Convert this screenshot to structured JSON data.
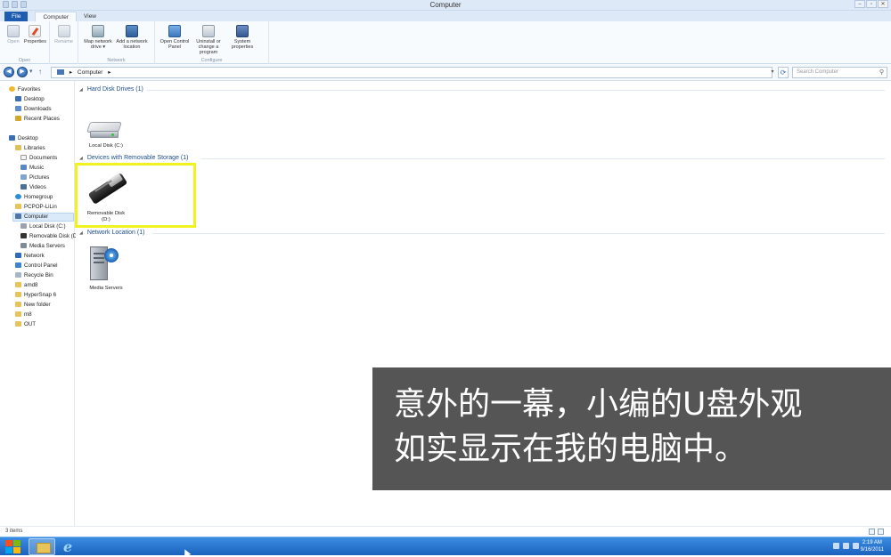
{
  "window": {
    "title": "Computer"
  },
  "tabs": [
    {
      "label": "File"
    },
    {
      "label": "Computer"
    },
    {
      "label": "View"
    }
  ],
  "ribbon": {
    "groups": [
      {
        "label": "Open",
        "buttons": [
          {
            "label": "Open"
          },
          {
            "label": "Properties"
          }
        ]
      },
      {
        "label": "",
        "buttons": [
          {
            "label": "Rename"
          }
        ]
      },
      {
        "label": "Network",
        "buttons": [
          {
            "label": "Map network drive ▾"
          },
          {
            "label": "Add a network location"
          }
        ]
      },
      {
        "label": "Configure",
        "buttons": [
          {
            "label": "Open Control Panel"
          },
          {
            "label": "Uninstall or change a program"
          },
          {
            "label": "System properties"
          }
        ]
      }
    ]
  },
  "address": {
    "path": "Computer",
    "search_placeholder": "Search Computer"
  },
  "nav": [
    {
      "label": "Favorites",
      "icon": "star-icon"
    },
    {
      "label": "Desktop",
      "icon": "desktop-icon"
    },
    {
      "label": "Downloads",
      "icon": "downloads-icon"
    },
    {
      "label": "Recent Places",
      "icon": "recent-places-icon"
    },
    {
      "label": "Desktop",
      "icon": "desktop-icon"
    },
    {
      "label": "Libraries",
      "icon": "libraries-icon"
    },
    {
      "label": "Documents",
      "icon": "documents-icon"
    },
    {
      "label": "Music",
      "icon": "music-icon"
    },
    {
      "label": "Pictures",
      "icon": "pictures-icon"
    },
    {
      "label": "Videos",
      "icon": "videos-icon"
    },
    {
      "label": "Homegroup",
      "icon": "homegroup-icon"
    },
    {
      "label": "PCPOP-LiLin",
      "icon": "user-folder-icon"
    },
    {
      "label": "Computer",
      "icon": "computer-icon"
    },
    {
      "label": "Local Disk (C:)",
      "icon": "hard-drive-icon"
    },
    {
      "label": "Removable Disk (D",
      "icon": "usb-drive-icon"
    },
    {
      "label": "Media Servers",
      "icon": "media-server-icon"
    },
    {
      "label": "Network",
      "icon": "network-icon"
    },
    {
      "label": "Control Panel",
      "icon": "control-panel-icon"
    },
    {
      "label": "Recycle Bin",
      "icon": "recycle-bin-icon"
    },
    {
      "label": "amd8",
      "icon": "folder-icon"
    },
    {
      "label": "HyperSnap 6",
      "icon": "folder-icon"
    },
    {
      "label": "New folder",
      "icon": "folder-icon"
    },
    {
      "label": "m8",
      "icon": "folder-icon"
    },
    {
      "label": "OUT",
      "icon": "folder-icon"
    }
  ],
  "content": {
    "groups": [
      {
        "header": "Hard Disk Drives (1)",
        "items": [
          {
            "label": "Local Disk (C:)",
            "icon": "hard-drive-icon"
          }
        ]
      },
      {
        "header": "Devices with Removable Storage (1)",
        "items": [
          {
            "label": "Removable Disk",
            "label2": "(D:)",
            "icon": "usb-drive-icon"
          }
        ]
      },
      {
        "header": "Network Location (1)",
        "items": [
          {
            "label": "Media Servers",
            "icon": "media-server-icon"
          }
        ]
      }
    ]
  },
  "status": {
    "count": "3 items"
  },
  "subtitle": {
    "line1": "意外的一幕，小编的U盘外观",
    "line2": "如实显示在我的电脑中。"
  },
  "taskbar": {
    "time": "2:19 AM",
    "date": "9/16/2011"
  },
  "colors": {
    "accent": "#1e5cb0",
    "highlight": "#f2f21f",
    "taskbar": "#2a74cf"
  }
}
